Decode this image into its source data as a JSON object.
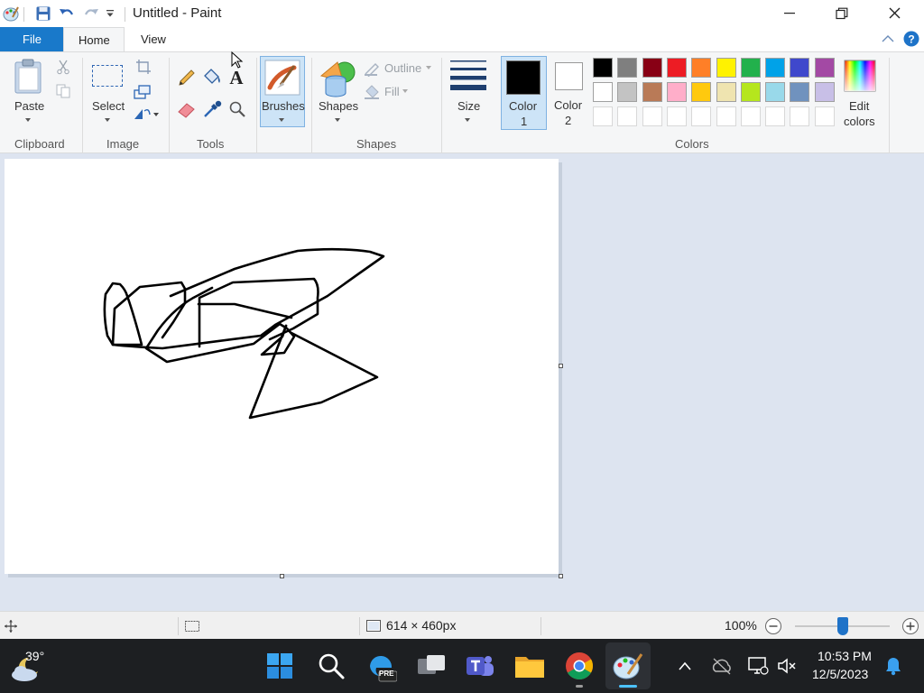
{
  "window": {
    "title": "Untitled - Paint"
  },
  "menu": {
    "file": "File",
    "home": "Home",
    "view": "View"
  },
  "ribbon": {
    "paste": "Paste",
    "clipboard": "Clipboard",
    "select": "Select",
    "image": "Image",
    "tools": "Tools",
    "brushes": "Brushes",
    "shapes": "Shapes",
    "shapes_group": "Shapes",
    "outline": "Outline",
    "fill": "Fill",
    "size": "Size",
    "color1": "Color",
    "color1_num": "1",
    "color2": "Color",
    "color2_num": "2",
    "edit_colors_1": "Edit",
    "edit_colors_2": "colors",
    "colors_group": "Colors"
  },
  "palette": {
    "row1": [
      "#000000",
      "#7f7f7f",
      "#880015",
      "#ed1c24",
      "#ff7f27",
      "#fff200",
      "#22b14c",
      "#00a2e8",
      "#3f48cc",
      "#a349a4"
    ],
    "row2": [
      "#ffffff",
      "#c3c3c3",
      "#b97a57",
      "#ffaec9",
      "#ffc90e",
      "#efe4b0",
      "#b5e61d",
      "#99d9ea",
      "#7092be",
      "#c8bfe7"
    ]
  },
  "status": {
    "canvas_size": "614 × 460px",
    "zoom": "100%",
    "zoom_level": 0.5
  },
  "taskbar": {
    "temperature": "39°",
    "time": "10:53 PM",
    "date": "12/5/2023",
    "pre_badge": "PRE"
  }
}
